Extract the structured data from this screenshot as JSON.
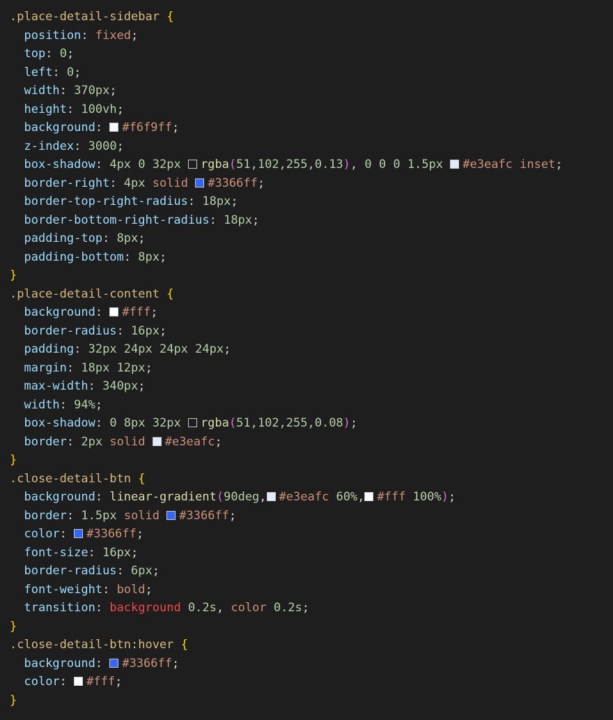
{
  "editor": {
    "colors": {
      "background": "#1e1e1e",
      "selector": "#d7ba7d",
      "brace": "#ffd700",
      "property": "#9cdcfe",
      "keyword_value": "#ce9178",
      "number": "#b5cea8",
      "function": "#dcdcaa",
      "paren": "#da70d6",
      "transition_keyword": "#f44747"
    },
    "lines": [
      [
        {
          "t": ".place-detail-sidebar",
          "c": "sel"
        },
        {
          "t": " "
        },
        {
          "t": "{",
          "c": "brace"
        }
      ],
      [
        {
          "t": "  "
        },
        {
          "t": "position",
          "c": "prop"
        },
        {
          "t": ": "
        },
        {
          "t": "fixed",
          "c": "val"
        },
        {
          "t": ";"
        }
      ],
      [
        {
          "t": "  "
        },
        {
          "t": "top",
          "c": "prop"
        },
        {
          "t": ": "
        },
        {
          "t": "0",
          "c": "num"
        },
        {
          "t": ";"
        }
      ],
      [
        {
          "t": "  "
        },
        {
          "t": "left",
          "c": "prop"
        },
        {
          "t": ": "
        },
        {
          "t": "0",
          "c": "num"
        },
        {
          "t": ";"
        }
      ],
      [
        {
          "t": "  "
        },
        {
          "t": "width",
          "c": "prop"
        },
        {
          "t": ": "
        },
        {
          "t": "370px",
          "c": "num"
        },
        {
          "t": ";"
        }
      ],
      [
        {
          "t": "  "
        },
        {
          "t": "height",
          "c": "prop"
        },
        {
          "t": ": "
        },
        {
          "t": "100vh",
          "c": "num"
        },
        {
          "t": ";"
        }
      ],
      [
        {
          "t": "  "
        },
        {
          "t": "background",
          "c": "prop"
        },
        {
          "t": ": "
        },
        {
          "sw": "#f6f9ff"
        },
        {
          "t": "#f6f9ff",
          "c": "val"
        },
        {
          "t": ";"
        }
      ],
      [
        {
          "t": "  "
        },
        {
          "t": "z-index",
          "c": "prop"
        },
        {
          "t": ": "
        },
        {
          "t": "3000",
          "c": "num"
        },
        {
          "t": ";"
        }
      ],
      [
        {
          "t": "  "
        },
        {
          "t": "box-shadow",
          "c": "prop"
        },
        {
          "t": ": "
        },
        {
          "t": "4px 0 32px",
          "c": "num"
        },
        {
          "t": " "
        },
        {
          "sw": "#1e1e1e"
        },
        {
          "t": "rgba",
          "c": "func"
        },
        {
          "t": "(",
          "c": "paren"
        },
        {
          "t": "51,102,255,0.13",
          "c": "num"
        },
        {
          "t": ")",
          "c": "paren"
        },
        {
          "t": ", "
        },
        {
          "t": "0 0 0 1.5px",
          "c": "num"
        },
        {
          "t": " "
        },
        {
          "sw": "#e3eafc"
        },
        {
          "t": "#e3eafc",
          "c": "val"
        },
        {
          "t": " "
        },
        {
          "t": "inset",
          "c": "val"
        },
        {
          "t": ";"
        }
      ],
      [
        {
          "t": "  "
        },
        {
          "t": "border-right",
          "c": "prop"
        },
        {
          "t": ": "
        },
        {
          "t": "4px",
          "c": "num"
        },
        {
          "t": " "
        },
        {
          "t": "solid",
          "c": "val"
        },
        {
          "t": " "
        },
        {
          "sw": "#3366ff"
        },
        {
          "t": "#3366ff",
          "c": "val"
        },
        {
          "t": ";"
        }
      ],
      [
        {
          "t": "  "
        },
        {
          "t": "border-top-right-radius",
          "c": "prop"
        },
        {
          "t": ": "
        },
        {
          "t": "18px",
          "c": "num"
        },
        {
          "t": ";"
        }
      ],
      [
        {
          "t": "  "
        },
        {
          "t": "border-bottom-right-radius",
          "c": "prop"
        },
        {
          "t": ": "
        },
        {
          "t": "18px",
          "c": "num"
        },
        {
          "t": ";"
        }
      ],
      [
        {
          "t": "  "
        },
        {
          "t": "padding-top",
          "c": "prop"
        },
        {
          "t": ": "
        },
        {
          "t": "8px",
          "c": "num"
        },
        {
          "t": ";"
        }
      ],
      [
        {
          "t": "  "
        },
        {
          "t": "padding-bottom",
          "c": "prop"
        },
        {
          "t": ": "
        },
        {
          "t": "8px",
          "c": "num"
        },
        {
          "t": ";"
        }
      ],
      [
        {
          "t": "}",
          "c": "brace"
        }
      ],
      [
        {
          "t": ".place-detail-content",
          "c": "sel"
        },
        {
          "t": " "
        },
        {
          "t": "{",
          "c": "brace"
        }
      ],
      [
        {
          "t": "  "
        },
        {
          "t": "background",
          "c": "prop"
        },
        {
          "t": ": "
        },
        {
          "sw": "#ffffff"
        },
        {
          "t": "#fff",
          "c": "val"
        },
        {
          "t": ";"
        }
      ],
      [
        {
          "t": "  "
        },
        {
          "t": "border-radius",
          "c": "prop"
        },
        {
          "t": ": "
        },
        {
          "t": "16px",
          "c": "num"
        },
        {
          "t": ";"
        }
      ],
      [
        {
          "t": "  "
        },
        {
          "t": "padding",
          "c": "prop"
        },
        {
          "t": ": "
        },
        {
          "t": "32px 24px 24px 24px",
          "c": "num"
        },
        {
          "t": ";"
        }
      ],
      [
        {
          "t": "  "
        },
        {
          "t": "margin",
          "c": "prop"
        },
        {
          "t": ": "
        },
        {
          "t": "18px 12px",
          "c": "num"
        },
        {
          "t": ";"
        }
      ],
      [
        {
          "t": "  "
        },
        {
          "t": "max-width",
          "c": "prop"
        },
        {
          "t": ": "
        },
        {
          "t": "340px",
          "c": "num"
        },
        {
          "t": ";"
        }
      ],
      [
        {
          "t": "  "
        },
        {
          "t": "width",
          "c": "prop"
        },
        {
          "t": ": "
        },
        {
          "t": "94%",
          "c": "num"
        },
        {
          "t": ";"
        }
      ],
      [
        {
          "t": "  "
        },
        {
          "t": "box-shadow",
          "c": "prop"
        },
        {
          "t": ": "
        },
        {
          "t": "0 8px 32px",
          "c": "num"
        },
        {
          "t": " "
        },
        {
          "sw": "#1e1e1e"
        },
        {
          "t": "rgba",
          "c": "func"
        },
        {
          "t": "(",
          "c": "paren"
        },
        {
          "t": "51,102,255,0.08",
          "c": "num"
        },
        {
          "t": ")",
          "c": "paren"
        },
        {
          "t": ";"
        }
      ],
      [
        {
          "t": "  "
        },
        {
          "t": "border",
          "c": "prop"
        },
        {
          "t": ": "
        },
        {
          "t": "2px",
          "c": "num"
        },
        {
          "t": " "
        },
        {
          "t": "solid",
          "c": "val"
        },
        {
          "t": " "
        },
        {
          "sw": "#e3eafc"
        },
        {
          "t": "#e3eafc",
          "c": "val"
        },
        {
          "t": ";"
        }
      ],
      [
        {
          "t": "}",
          "c": "brace"
        }
      ],
      [
        {
          "t": ".close-detail-btn",
          "c": "sel"
        },
        {
          "t": " "
        },
        {
          "t": "{",
          "c": "brace"
        }
      ],
      [
        {
          "t": "  "
        },
        {
          "t": "background",
          "c": "prop"
        },
        {
          "t": ": "
        },
        {
          "t": "linear-gradient",
          "c": "func"
        },
        {
          "t": "(",
          "c": "paren"
        },
        {
          "t": "90deg",
          "c": "num"
        },
        {
          "t": ","
        },
        {
          "sw": "#e3eafc"
        },
        {
          "t": "#e3eafc",
          "c": "val"
        },
        {
          "t": " "
        },
        {
          "t": "60%",
          "c": "num"
        },
        {
          "t": ","
        },
        {
          "sw": "#ffffff"
        },
        {
          "t": "#fff",
          "c": "val"
        },
        {
          "t": " "
        },
        {
          "t": "100%",
          "c": "num"
        },
        {
          "t": ")",
          "c": "paren"
        },
        {
          "t": ";"
        }
      ],
      [
        {
          "t": "  "
        },
        {
          "t": "border",
          "c": "prop"
        },
        {
          "t": ": "
        },
        {
          "t": "1.5px",
          "c": "num"
        },
        {
          "t": " "
        },
        {
          "t": "solid",
          "c": "val"
        },
        {
          "t": " "
        },
        {
          "sw": "#3366ff"
        },
        {
          "t": "#3366ff",
          "c": "val"
        },
        {
          "t": ";"
        }
      ],
      [
        {
          "t": "  "
        },
        {
          "t": "color",
          "c": "prop"
        },
        {
          "t": ": "
        },
        {
          "sw": "#3366ff"
        },
        {
          "t": "#3366ff",
          "c": "val"
        },
        {
          "t": ";"
        }
      ],
      [
        {
          "t": "  "
        },
        {
          "t": "font-size",
          "c": "prop"
        },
        {
          "t": ": "
        },
        {
          "t": "16px",
          "c": "num"
        },
        {
          "t": ";"
        }
      ],
      [
        {
          "t": "  "
        },
        {
          "t": "border-radius",
          "c": "prop"
        },
        {
          "t": ": "
        },
        {
          "t": "6px",
          "c": "num"
        },
        {
          "t": ";"
        }
      ],
      [
        {
          "t": "  "
        },
        {
          "t": "font-weight",
          "c": "prop"
        },
        {
          "t": ": "
        },
        {
          "t": "bold",
          "c": "val"
        },
        {
          "t": ";"
        }
      ],
      [
        {
          "t": "  "
        },
        {
          "t": "transition",
          "c": "prop"
        },
        {
          "t": ": "
        },
        {
          "t": "background",
          "c": "kw"
        },
        {
          "t": " "
        },
        {
          "t": "0.2s",
          "c": "num"
        },
        {
          "t": ", "
        },
        {
          "t": "color",
          "c": "val"
        },
        {
          "t": " "
        },
        {
          "t": "0.2s",
          "c": "num"
        },
        {
          "t": ";"
        }
      ],
      [
        {
          "t": "}",
          "c": "brace"
        }
      ],
      [
        {
          "t": ".close-detail-btn:hover",
          "c": "sel"
        },
        {
          "t": " "
        },
        {
          "t": "{",
          "c": "brace"
        }
      ],
      [
        {
          "t": "  "
        },
        {
          "t": "background",
          "c": "prop"
        },
        {
          "t": ": "
        },
        {
          "sw": "#3366ff"
        },
        {
          "t": "#3366ff",
          "c": "val"
        },
        {
          "t": ";"
        }
      ],
      [
        {
          "t": "  "
        },
        {
          "t": "color",
          "c": "prop"
        },
        {
          "t": ": "
        },
        {
          "sw": "#ffffff"
        },
        {
          "t": "#fff",
          "c": "val"
        },
        {
          "t": ";"
        }
      ],
      [
        {
          "t": "}",
          "c": "brace"
        }
      ]
    ]
  }
}
